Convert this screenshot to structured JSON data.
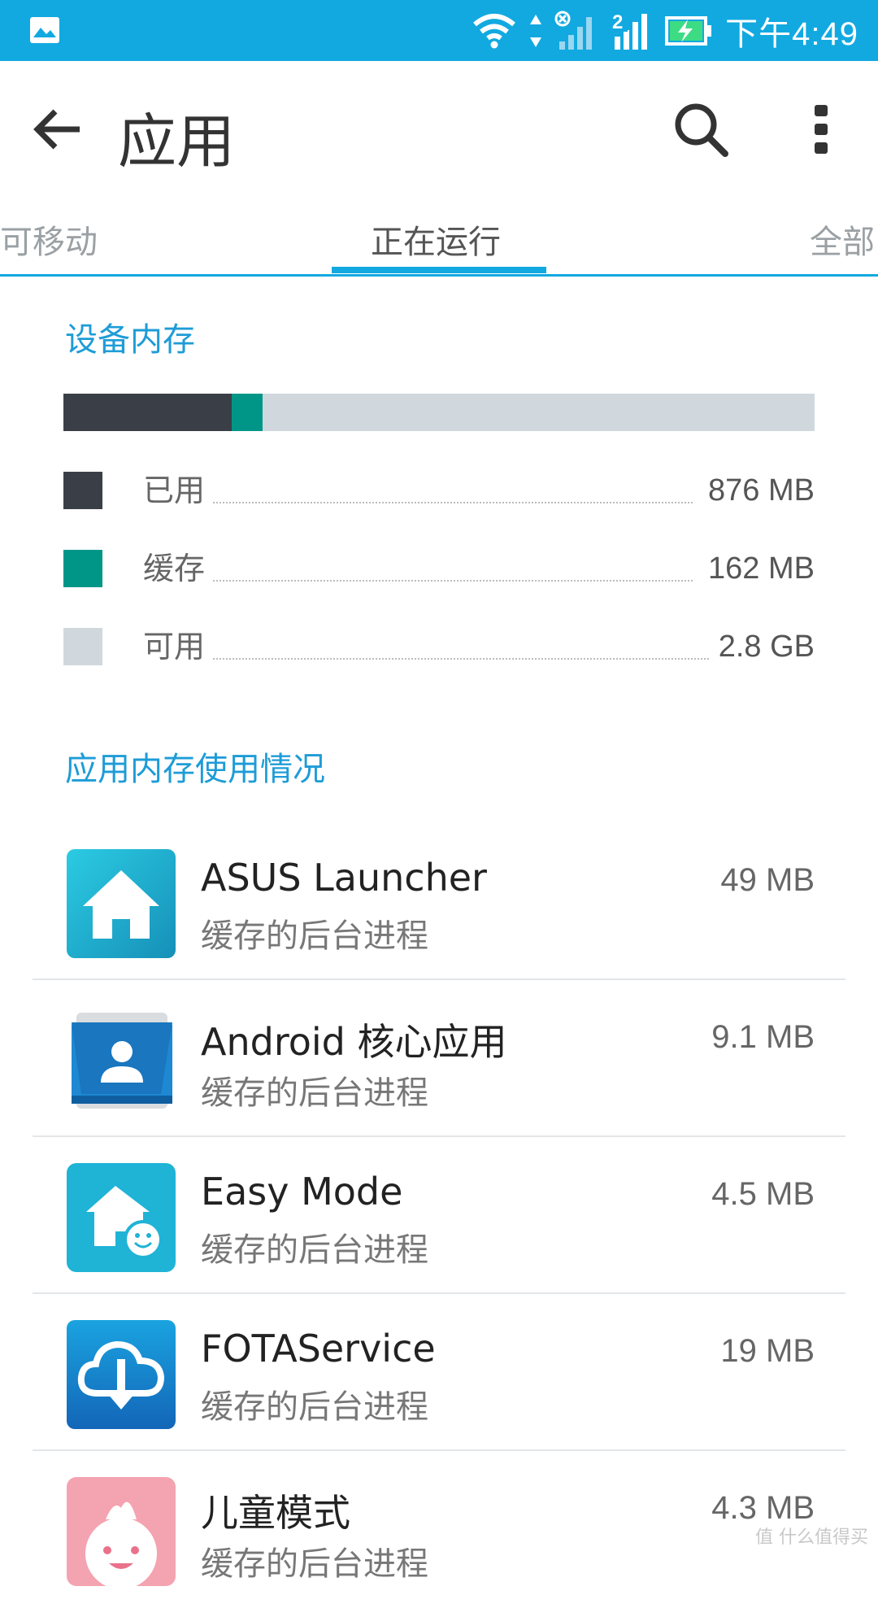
{
  "status_bar": {
    "time": "下午4:49",
    "icons": [
      "gallery-icon",
      "wifi-icon",
      "data-arrows-icon",
      "signal-icon-sim1-no-service",
      "signal-icon-sim2",
      "battery-charging-icon"
    ],
    "sim2_label": "2",
    "color": "#12A9E1"
  },
  "app_bar": {
    "title": "应用",
    "back_icon": "arrow-back-icon",
    "search_icon": "search-icon",
    "more_icon": "more-vert-icon"
  },
  "tabs": [
    {
      "label": "可移动",
      "active": false
    },
    {
      "label": "正在运行",
      "active": true
    },
    {
      "label": "全部",
      "active": false
    }
  ],
  "device_memory": {
    "title": "设备内存",
    "usage_fractions": {
      "used": 0.224,
      "cached": 0.041,
      "free": 0.735
    },
    "legend": [
      {
        "label": "已用",
        "value": "876 MB",
        "color": "#3A3F47"
      },
      {
        "label": "缓存",
        "value": "162 MB",
        "color": "#009687"
      },
      {
        "label": "可用",
        "value": "2.8 GB",
        "color": "#D0D8DE"
      }
    ]
  },
  "app_memory": {
    "title": "应用内存使用情况",
    "apps": [
      {
        "name": "ASUS Launcher",
        "status": "缓存的后台进程",
        "size": "49 MB",
        "icon": "home-icon"
      },
      {
        "name": "Android 核心应用",
        "status": "缓存的后台进程",
        "size": "9.1 MB",
        "icon": "contacts-icon"
      },
      {
        "name": "Easy Mode",
        "status": "缓存的后台进程",
        "size": "4.5 MB",
        "icon": "easy-mode-icon"
      },
      {
        "name": "FOTAService",
        "status": "缓存的后台进程",
        "size": "19 MB",
        "icon": "cloud-download-icon"
      },
      {
        "name": "儿童模式",
        "status": "缓存的后台进程",
        "size": "4.3 MB",
        "icon": "kids-mode-icon"
      }
    ]
  },
  "watermark": "值 什么值得买"
}
